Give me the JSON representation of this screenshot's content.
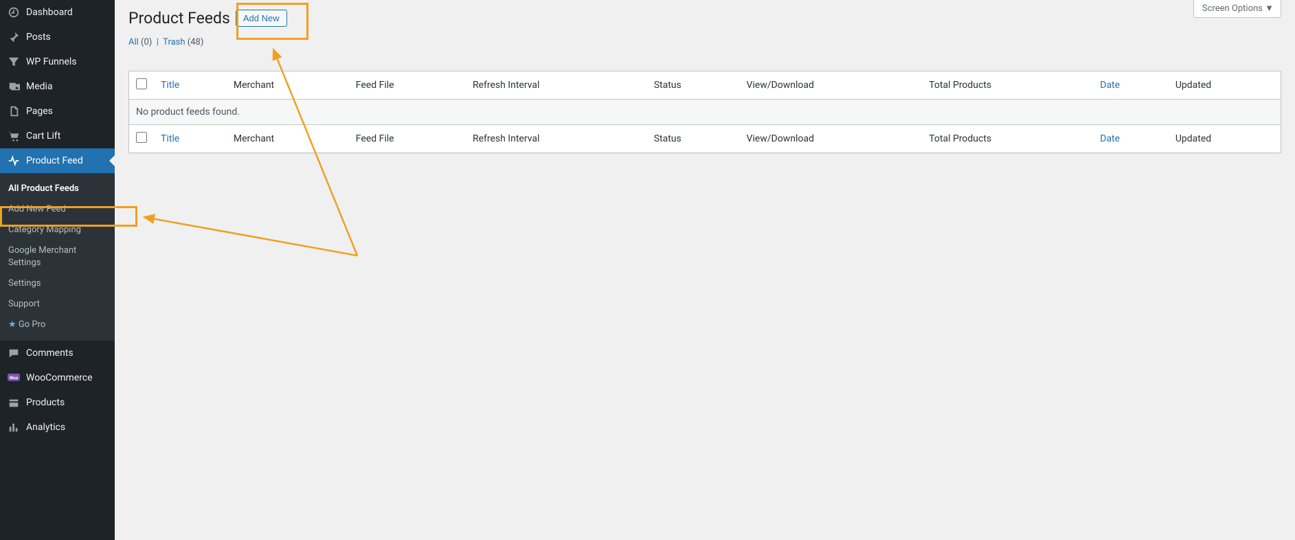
{
  "sidebar": {
    "items": [
      {
        "label": "Dashboard",
        "icon": "dashboard"
      },
      {
        "label": "Posts",
        "icon": "pin"
      },
      {
        "label": "WP Funnels",
        "icon": "funnel"
      },
      {
        "label": "Media",
        "icon": "media"
      },
      {
        "label": "Pages",
        "icon": "pages"
      },
      {
        "label": "Cart Lift",
        "icon": "cart"
      },
      {
        "label": "Product Feed",
        "icon": "pulse",
        "active": true
      },
      {
        "label": "Comments",
        "icon": "comment"
      },
      {
        "label": "WooCommerce",
        "icon": "woo"
      },
      {
        "label": "Products",
        "icon": "products"
      },
      {
        "label": "Analytics",
        "icon": "analytics"
      }
    ],
    "submenu": [
      {
        "label": "All Product Feeds",
        "current": true
      },
      {
        "label": "Add New Feed"
      },
      {
        "label": "Category Mapping"
      },
      {
        "label": "Google Merchant Settings"
      },
      {
        "label": "Settings"
      },
      {
        "label": "Support"
      },
      {
        "label": "Go Pro",
        "star": true
      }
    ]
  },
  "header": {
    "title": "Product Feeds",
    "add_new_label": "Add New",
    "screen_options_label": "Screen Options"
  },
  "filters": {
    "all_label": "All",
    "all_count": "(0)",
    "separator": "|",
    "trash_label": "Trash",
    "trash_count": "(48)"
  },
  "table": {
    "columns": {
      "title": "Title",
      "merchant": "Merchant",
      "feed_file": "Feed File",
      "refresh_interval": "Refresh Interval",
      "status": "Status",
      "view_download": "View/Download",
      "total_products": "Total Products",
      "date": "Date",
      "updated": "Updated"
    },
    "empty_message": "No product feeds found."
  }
}
